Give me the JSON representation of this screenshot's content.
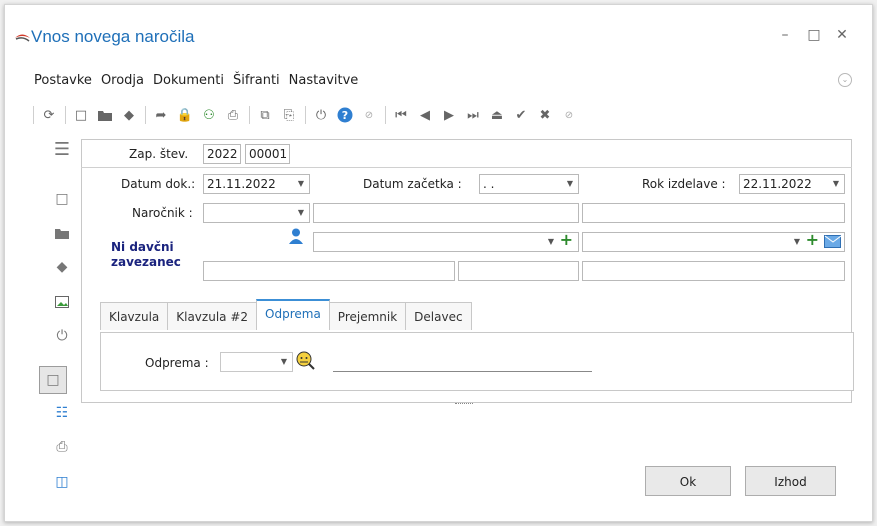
{
  "window": {
    "title": "Vnos novega naročila",
    "minimize": "–",
    "maximize": "□",
    "close": "✕"
  },
  "menu": [
    "Postavke",
    "Orodja",
    "Dokumenti",
    "Šifranti",
    "Nastavitve"
  ],
  "form": {
    "zap_label": "Zap. štev.",
    "zap_year": "2022",
    "zap_number": "00001",
    "datum_dok_label": "Datum dok.:",
    "datum_dok_value": "21.11.2022",
    "datum_zacetka_label": "Datum začetka :",
    "datum_zacetka_value": ". .",
    "rok_izdelave_label": "Rok izdelave :",
    "rok_izdelave_value": "22.11.2022",
    "narocnik_label": "Naročnik :",
    "ni_davcni_line1": "Ni davčni",
    "ni_davcni_line2": "zavezanec"
  },
  "tabs": [
    "Klavzula",
    "Klavzula #2",
    "Odprema",
    "Prejemnik",
    "Delavec"
  ],
  "active_tab": "Odprema",
  "odprema": {
    "label": "Odprema :"
  },
  "buttons": {
    "ok": "Ok",
    "izhod": "Izhod"
  },
  "colors": {
    "accent": "#1e6fb8",
    "ni_davcni": "#1a237e",
    "plus_green": "#2e8b2e"
  }
}
